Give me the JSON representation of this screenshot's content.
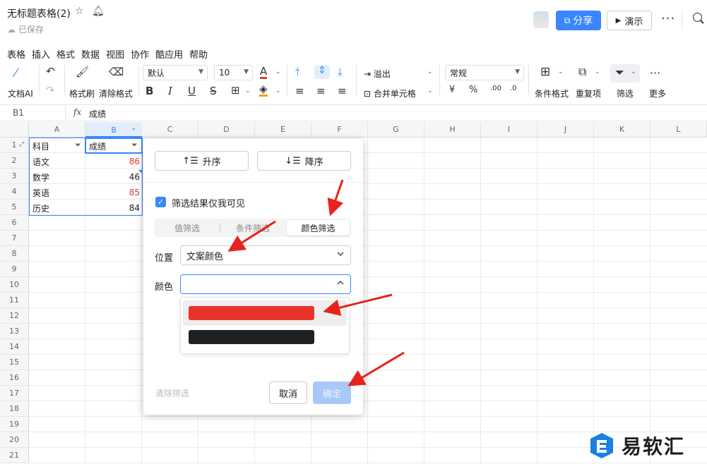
{
  "app": {
    "title": "无标题表格(2)",
    "saved_status": "已保存",
    "share_label": "分享",
    "present_label": "演示",
    "accent_color": "#3a86ff"
  },
  "menu": [
    "表格",
    "插入",
    "格式",
    "数据",
    "视图",
    "协作",
    "酷应用",
    "帮助"
  ],
  "toolbar": {
    "ai_label": "文档AI",
    "format_painter_label": "格式刷",
    "clear_format_label": "清除格式",
    "font_family": "默认",
    "font_size": "10",
    "overflow_label": "溢出",
    "merge_label": "合并单元格",
    "number_format": "常规",
    "conditional_format_label": "条件格式",
    "duplicates_label": "重复项",
    "filter_label": "筛选",
    "more_label": "更多"
  },
  "formula_bar": {
    "cell_ref": "B1",
    "fx": "fx",
    "value": "成绩"
  },
  "grid": {
    "columns": [
      "A",
      "B",
      "C",
      "D",
      "E",
      "F",
      "G",
      "H",
      "I",
      "J",
      "K",
      "L"
    ],
    "rows": [
      "1",
      "2",
      "3",
      "4",
      "5",
      "6",
      "7",
      "8",
      "9",
      "10",
      "11",
      "12",
      "13",
      "14",
      "15",
      "16",
      "17",
      "18",
      "19",
      "20",
      "21"
    ],
    "data": [
      {
        "a": "科目",
        "b": "成绩",
        "b_color": "#222222"
      },
      {
        "a": "语文",
        "b": "86",
        "b_color": "#e53935"
      },
      {
        "a": "数学",
        "b": "46",
        "b_color": "#222222"
      },
      {
        "a": "英语",
        "b": "85",
        "b_color": "#e53935"
      },
      {
        "a": "历史",
        "b": "84",
        "b_color": "#222222"
      }
    ]
  },
  "filter_dialog": {
    "sort_asc_label": "升序",
    "sort_desc_label": "降序",
    "only_me_label": "筛选结果仅我可见",
    "tabs": [
      "值筛选",
      "条件筛选",
      "颜色筛选"
    ],
    "active_tab": "颜色筛选",
    "position_label": "位置",
    "position_value": "文案颜色",
    "color_label": "颜色",
    "color_options": [
      "#e8332a",
      "#1f2023"
    ],
    "clear_label": "清除筛选",
    "cancel_label": "取消",
    "confirm_label": "确定"
  },
  "watermark": {
    "text": "易软汇"
  }
}
